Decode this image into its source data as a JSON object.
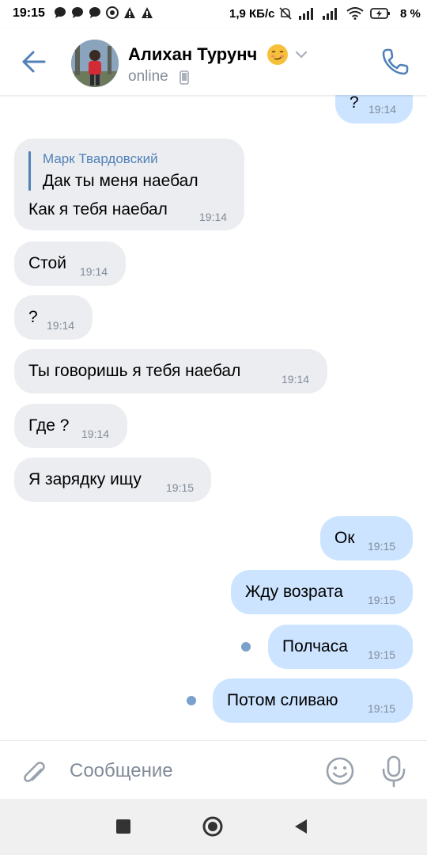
{
  "status_bar": {
    "time": "19:15",
    "speed": "1,9 КБ/с",
    "battery": "8 %"
  },
  "header": {
    "contact_name": "Алихан Турунч",
    "status": "online",
    "emoji_icon": "smirk-face-icon"
  },
  "messages": [
    {
      "direction": "out",
      "text": "?",
      "time": "19:14"
    },
    {
      "direction": "in",
      "reply_author": "Марк Твардовский",
      "reply_text": "Дак ты меня наебал",
      "text": "Как я тебя наебал",
      "time": "19:14"
    },
    {
      "direction": "in",
      "text": "Стой",
      "time": "19:14"
    },
    {
      "direction": "in",
      "text": "?",
      "time": "19:14"
    },
    {
      "direction": "in",
      "text": "Ты говоришь я тебя наебал",
      "time": "19:14"
    },
    {
      "direction": "in",
      "text": "Где ?",
      "time": "19:14"
    },
    {
      "direction": "in",
      "text": "Я зарядку ищу",
      "time": "19:15"
    },
    {
      "direction": "out",
      "text": "Ок",
      "time": "19:15"
    },
    {
      "direction": "out",
      "text": "Жду возрата",
      "time": "19:15"
    },
    {
      "direction": "out",
      "text": "Полчаса",
      "time": "19:15",
      "unread": true
    },
    {
      "direction": "out",
      "text": "Потом сливаю",
      "time": "19:15",
      "unread": true
    }
  ],
  "composer": {
    "placeholder": "Сообщение"
  },
  "colors": {
    "accent": "#5181b8",
    "incoming_bubble": "#ebedf0",
    "outgoing_bubble": "#cce4ff",
    "secondary_text": "#818c99"
  }
}
